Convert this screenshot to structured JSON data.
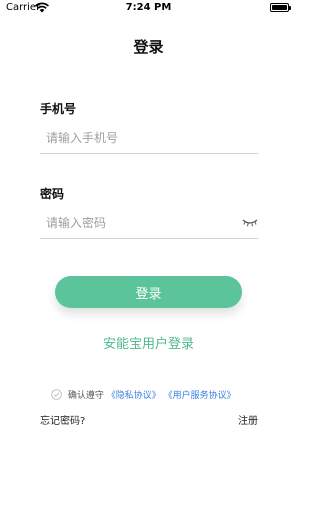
{
  "status_bar": {
    "carrier": "Carrier",
    "time": "7:24 PM",
    "battery_level": 1.0
  },
  "header": {
    "title": "登录"
  },
  "form": {
    "phone_label": "手机号",
    "phone_placeholder": "请输入手机号",
    "phone_value": "",
    "password_label": "密码",
    "password_placeholder": "请输入密码",
    "password_value": "",
    "password_toggle_icon": "eye-closed-icon",
    "login_button": "登录",
    "alt_login": "安能宝用户登录"
  },
  "agreement": {
    "checked": false,
    "prefix": "确认遵守",
    "privacy_link": "《隐私协议》",
    "service_link": "《用户服务协议》"
  },
  "footer": {
    "forgot_password": "忘记密码?",
    "register": "注册"
  },
  "colors": {
    "primary": "#5cc49a",
    "link": "#3a7fe0",
    "alt_text": "#4fba8c"
  }
}
